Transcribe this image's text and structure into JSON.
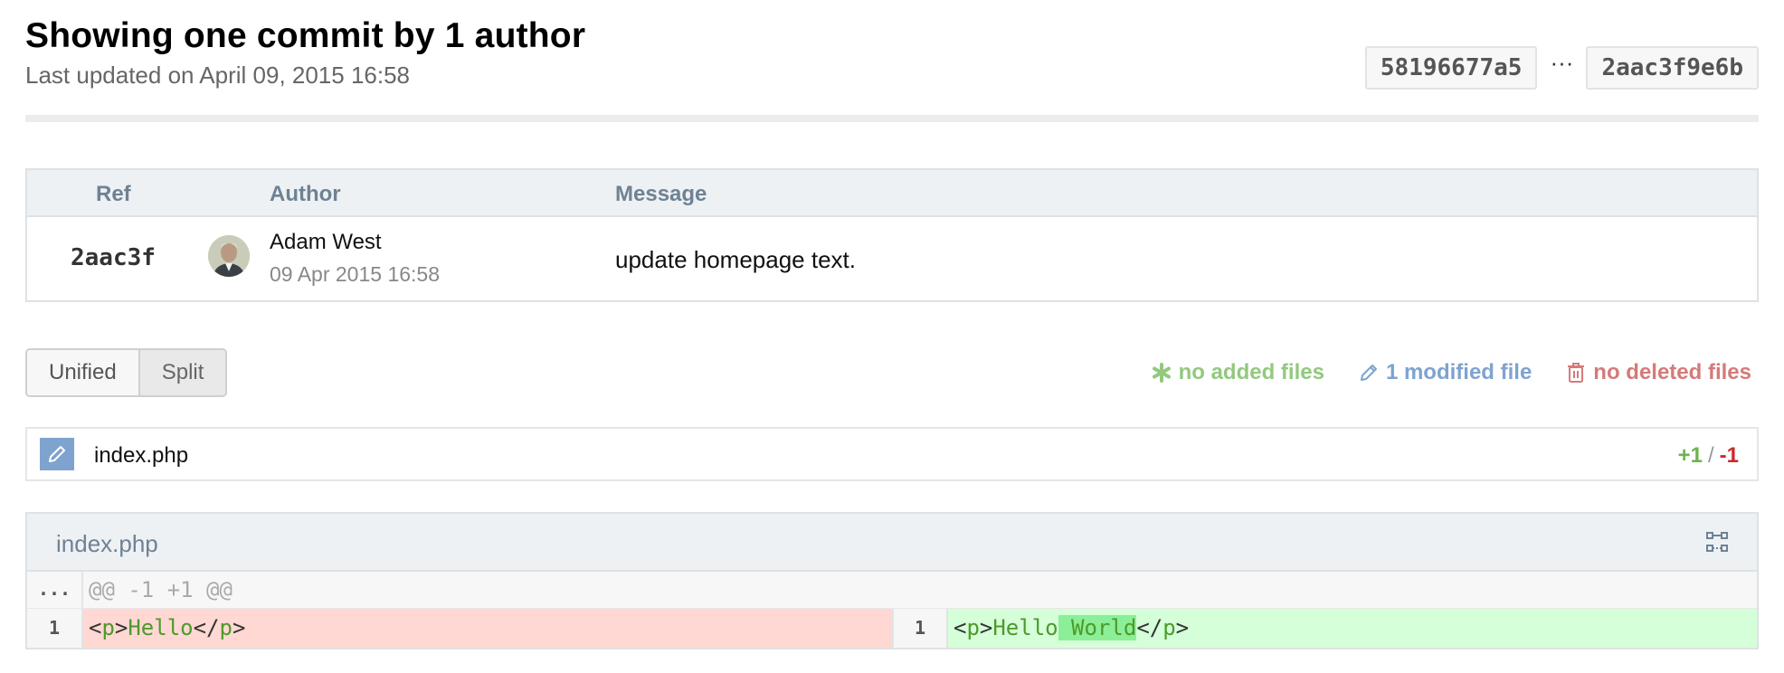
{
  "header": {
    "title": "Showing one commit by 1 author",
    "subtitle": "Last updated on April 09, 2015 16:58"
  },
  "compare": {
    "from_sha": "58196677a5",
    "separator": "···",
    "to_sha": "2aac3f9e6b"
  },
  "commits_table": {
    "columns": {
      "ref": "Ref",
      "author": "Author",
      "message": "Message"
    },
    "rows": [
      {
        "ref": "2aac3f",
        "author_name": "Adam West",
        "date": "09 Apr 2015 16:58",
        "message": "update homepage text."
      }
    ]
  },
  "view_toggle": {
    "unified": "Unified",
    "split": "Split"
  },
  "file_stats": {
    "added": "no added files",
    "modified": "1 modified file",
    "deleted": "no deleted files",
    "colors": {
      "added": "#92c97e",
      "modified": "#7ea3cf",
      "deleted": "#d47a7a"
    }
  },
  "file_list": [
    {
      "name": "index.php",
      "additions": "+1",
      "separator": "/",
      "deletions": "-1",
      "icon": "pencil-icon"
    }
  ],
  "diff": {
    "file": "index.php",
    "hunk_gutter": "...",
    "hunk_header": "@@ -1 +1 @@",
    "left": {
      "line": "1",
      "open_lt": "<",
      "tag_open": "p",
      "gt1": ">",
      "text": "Hello",
      "close_lt": "</",
      "tag_close": "p",
      "gt2": ">"
    },
    "right": {
      "line": "1",
      "open_lt": "<",
      "tag_open": "p",
      "gt1": ">",
      "text": "Hello",
      "added": " World",
      "close_lt": "</",
      "tag_close": "p",
      "gt2": ">"
    }
  }
}
